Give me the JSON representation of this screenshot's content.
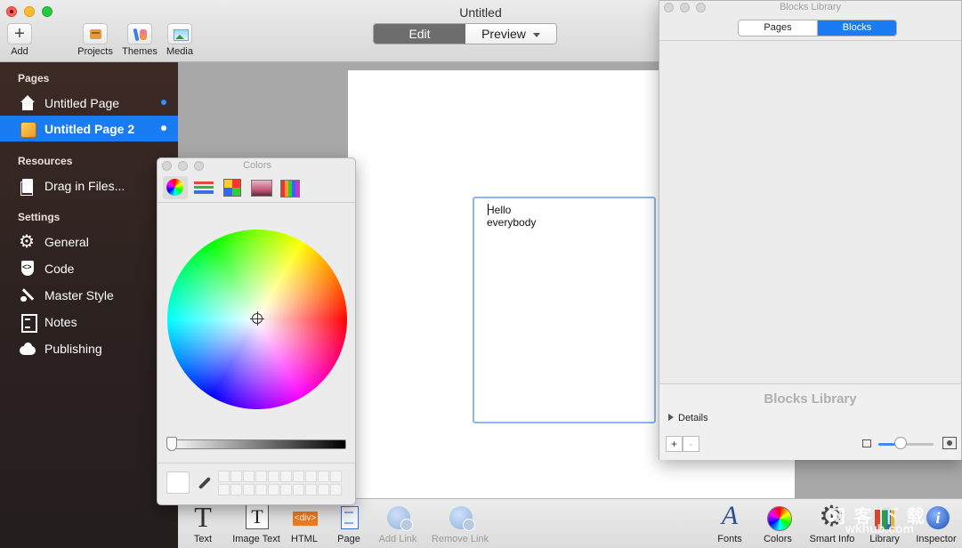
{
  "window": {
    "title": "Untitled"
  },
  "toolbar": {
    "add_label": "Add",
    "projects_label": "Projects",
    "themes_label": "Themes",
    "media_label": "Media",
    "mode": {
      "edit_label": "Edit",
      "preview_label": "Preview",
      "selected": "Edit"
    }
  },
  "sidebar": {
    "pages_heading": "Pages",
    "pages": [
      {
        "label": "Untitled Page",
        "icon": "house-icon",
        "selected": false
      },
      {
        "label": "Untitled Page 2",
        "icon": "cube-icon",
        "selected": true
      }
    ],
    "resources_heading": "Resources",
    "resources": [
      {
        "label": "Drag in Files...",
        "icon": "file-icon"
      }
    ],
    "settings_heading": "Settings",
    "settings": [
      {
        "label": "General",
        "icon": "gear-icon"
      },
      {
        "label": "Code",
        "icon": "code-icon"
      },
      {
        "label": "Master Style",
        "icon": "brush-icon"
      },
      {
        "label": "Notes",
        "icon": "notes-icon"
      },
      {
        "label": "Publishing",
        "icon": "cloud-icon"
      }
    ],
    "accent_color": "#1a7cf2"
  },
  "canvas": {
    "text_block": "Hello everybody"
  },
  "bottom_toolbar": {
    "text_label": "Text",
    "image_text_label": "Image Text",
    "html_label": "HTML",
    "page_label": "Page",
    "add_link_label": "Add Link",
    "remove_link_label": "Remove Link",
    "fonts_label": "Fonts",
    "colors_label": "Colors",
    "smart_info_label": "Smart Info",
    "library_label": "Library",
    "inspector_label": "Inspector"
  },
  "watermark": {
    "line1": "网 客 下 载",
    "line2": "wkhub.com"
  },
  "colors_panel": {
    "title": "Colors",
    "tabs": [
      "color-wheel-icon",
      "sliders-icon",
      "palettes-icon",
      "image-palette-icon",
      "crayons-icon"
    ],
    "active_tab": "color-wheel-icon",
    "selected_color": "#ffffff"
  },
  "blocks_library": {
    "title": "Blocks Library",
    "tabs": {
      "pages_label": "Pages",
      "blocks_label": "Blocks",
      "selected": "Blocks"
    },
    "empty_label": "Blocks Library",
    "details_label": "Details",
    "add_label": "+",
    "remove_label": "-"
  }
}
